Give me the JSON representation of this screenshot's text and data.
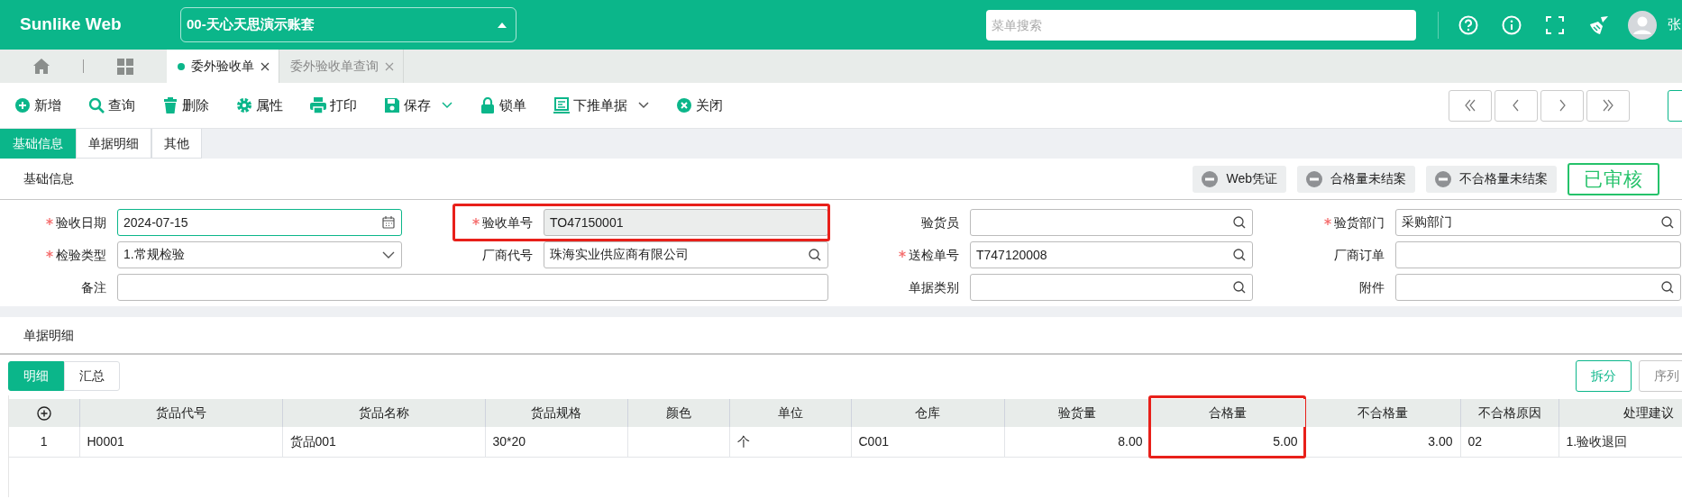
{
  "header": {
    "logo": "Sunlike Web",
    "account": "00-天心天思演示账套",
    "search": {
      "placeholder": "菜单搜索"
    },
    "user": "张"
  },
  "page_tabs": [
    {
      "label": "委外验收单",
      "selected": true
    },
    {
      "label": "委外验收单查询",
      "selected": false
    }
  ],
  "toolbar": [
    {
      "label": "新增",
      "kind": "add",
      "dropdown": false
    },
    {
      "label": "查询",
      "kind": "query",
      "dropdown": false
    },
    {
      "label": "删除",
      "kind": "delete",
      "dropdown": false
    },
    {
      "label": "属性",
      "kind": "properties",
      "dropdown": false
    },
    {
      "label": "打印",
      "kind": "print",
      "dropdown": false
    },
    {
      "label": "保存",
      "kind": "save",
      "dropdown": true
    },
    {
      "label": "锁单",
      "kind": "lock",
      "dropdown": false
    },
    {
      "label": "下推单据",
      "kind": "push",
      "dropdown": true
    },
    {
      "label": "关闭",
      "kind": "close",
      "dropdown": false
    }
  ],
  "form_tabs": [
    {
      "label": "基础信息",
      "selected": true
    },
    {
      "label": "单据明细",
      "selected": false
    },
    {
      "label": "其他",
      "selected": false
    }
  ],
  "section_title": "基础信息",
  "status_tags": [
    "Web凭证",
    "合格量未结案",
    "不合格量未结案"
  ],
  "stamp": "已审核",
  "fields": [
    {
      "label": "验收日期",
      "required": true,
      "kind": "date",
      "value": "2024-07-15",
      "focused": true,
      "readonly": false,
      "highlighted": false
    },
    {
      "label": "验收单号",
      "required": true,
      "kind": "text",
      "value": "TO47150001",
      "focused": false,
      "readonly": true,
      "highlighted": true
    },
    {
      "label": "验货员",
      "required": false,
      "kind": "lookup",
      "focused": false,
      "readonly": false,
      "highlighted": false
    },
    {
      "label": "验货部门",
      "required": true,
      "kind": "lookup",
      "value": "采购部门",
      "focused": false,
      "readonly": false,
      "highlighted": false
    },
    {
      "label": "检验类型",
      "required": true,
      "kind": "select",
      "value": "1.常规检验",
      "focused": false,
      "readonly": false,
      "highlighted": false
    },
    {
      "label": "厂商代号",
      "required": false,
      "kind": "lookup",
      "value": "珠海实业供应商有限公司",
      "focused": false,
      "readonly": false,
      "highlighted": false
    },
    {
      "label": "送检单号",
      "required": true,
      "kind": "lookup",
      "value": "T747120008",
      "focused": false,
      "readonly": false,
      "highlighted": false
    },
    {
      "label": "厂商订单",
      "required": false,
      "kind": "text",
      "focused": false,
      "readonly": false,
      "highlighted": false
    },
    {
      "label": "备注",
      "required": false,
      "kind": "text",
      "wide": true,
      "focused": false,
      "readonly": false,
      "highlighted": false
    },
    {
      "label": "单据类别",
      "required": false,
      "kind": "lookup",
      "focused": false,
      "readonly": false,
      "highlighted": false
    },
    {
      "label": "附件",
      "required": false,
      "kind": "lookup",
      "focused": false,
      "readonly": false,
      "highlighted": false
    }
  ],
  "detail_title": "单据明细",
  "detail_tabs": [
    {
      "label": "明细",
      "selected": true
    },
    {
      "label": "汇总",
      "selected": false
    }
  ],
  "detail_buttons": [
    "拆分",
    "序列"
  ],
  "table": {
    "columns": [
      {
        "kind": "index",
        "highlighted": false
      },
      {
        "label": "货品代号",
        "kind": "text",
        "highlighted": false
      },
      {
        "label": "货品名称",
        "kind": "text",
        "highlighted": false
      },
      {
        "label": "货品规格",
        "kind": "text",
        "highlighted": false
      },
      {
        "label": "颜色",
        "kind": "text",
        "highlighted": false
      },
      {
        "label": "单位",
        "kind": "text",
        "highlighted": false
      },
      {
        "label": "仓库",
        "kind": "text",
        "highlighted": false
      },
      {
        "label": "验货量",
        "kind": "number",
        "highlighted": false
      },
      {
        "label": "合格量",
        "kind": "number",
        "highlighted": true
      },
      {
        "label": "不合格量",
        "kind": "number",
        "highlighted": false
      },
      {
        "label": "不合格原因",
        "kind": "text",
        "highlighted": false
      },
      {
        "label": "处理建议",
        "kind": "text",
        "highlighted": false
      }
    ],
    "rows": [
      [
        "1",
        "H0001",
        "货品001",
        "30*20",
        "",
        "个",
        "C001",
        "8.00",
        "5.00",
        "3.00",
        "02",
        "1.验收退回"
      ]
    ]
  }
}
